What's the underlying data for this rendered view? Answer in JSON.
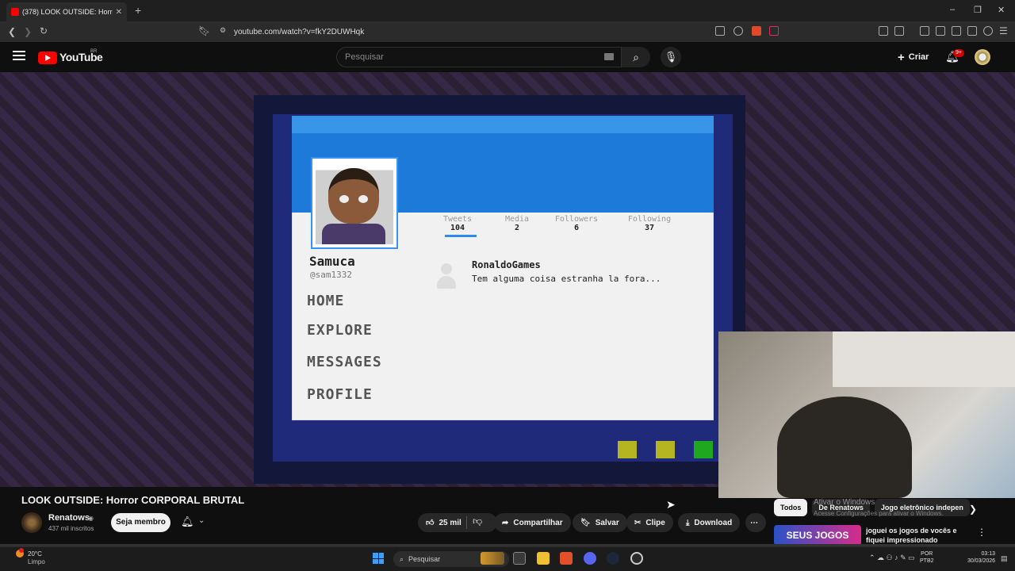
{
  "browser": {
    "tab_title": "(378) LOOK OUTSIDE: Horror",
    "new_tab": "+",
    "url": "youtube.com/watch?v=fkY2DUWHqk",
    "window_controls": [
      "–",
      "❐",
      "✕"
    ]
  },
  "youtube": {
    "logo_text": "YouTube",
    "country": "BR",
    "search_placeholder": "Pesquisar",
    "create_label": "Criar",
    "notif_count": "9+"
  },
  "game": {
    "profile_name": "Samuca",
    "profile_handle": "@sam1332",
    "stats": [
      {
        "label": "Tweets",
        "value": "104"
      },
      {
        "label": "Media",
        "value": "2"
      },
      {
        "label": "Followers",
        "value": "6"
      },
      {
        "label": "Following",
        "value": "37"
      }
    ],
    "nav": [
      "HOME",
      "EXPLORE",
      "MESSAGES",
      "PROFILE"
    ],
    "tweet_author": "RonaldoGames",
    "tweet_text": "Tem alguma coisa estranha la fora...",
    "squares": [
      "#b5b522",
      "#b5b522",
      "#1fa81f"
    ]
  },
  "video": {
    "title": "LOOK OUTSIDE: Horror CORPORAL BRUTAL",
    "channel_name": "Renatows",
    "subscribers": "437 mil inscritos",
    "join_label": "Seja membro",
    "likes": "25 mil",
    "share_label": "Compartilhar",
    "save_label": "Salvar",
    "clip_label": "Clipe",
    "download_label": "Download"
  },
  "sidebar": {
    "chips": [
      "Todos",
      "De Renatows",
      "Jogo eletrônico indepen"
    ],
    "activate_windows_title": "Ativar o Windows",
    "activate_windows_text": "Acesse Configurações para ativar o Windows.",
    "rec_thumb_text": "SEUS JOGOS",
    "rec_title": "joguei os jogos de vocês e fiquei impressionado"
  },
  "taskbar": {
    "temperature": "20°C",
    "condition": "Limpo",
    "search_placeholder": "Pesquisar",
    "lang_line1": "POR",
    "lang_line2": "PTB2",
    "time": "03:13",
    "date": "30/03/2026"
  }
}
